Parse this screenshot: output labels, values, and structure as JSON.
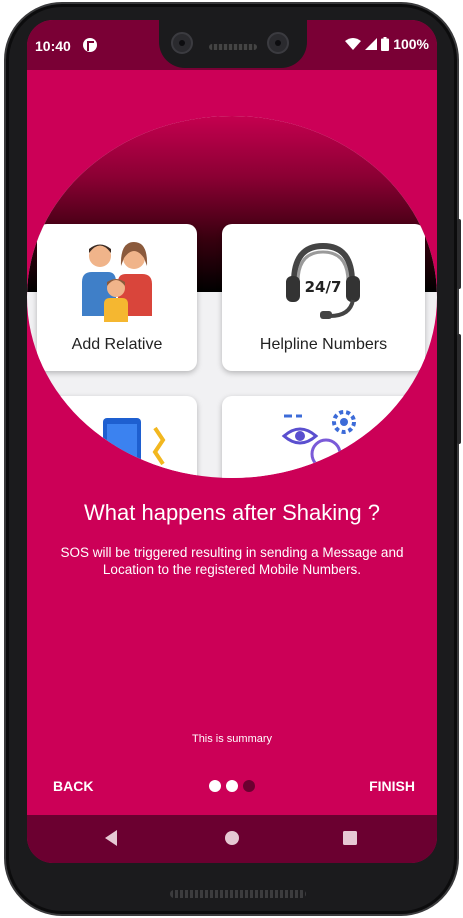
{
  "status_bar": {
    "time": "10:40",
    "battery": "100%",
    "icons": [
      "app-notification-icon",
      "wifi-icon",
      "signal-icon",
      "battery-icon"
    ]
  },
  "cards": [
    {
      "label": "Add Relative",
      "icon": "family-icon"
    },
    {
      "label": "Helpline Numbers",
      "icon": "headset-247-icon"
    },
    {
      "label": "",
      "icon": "phone-shake-icon"
    },
    {
      "label": "",
      "icon": "idea-settings-icon"
    }
  ],
  "intro": {
    "title": "What happens after Shaking ?",
    "description": "SOS will be triggered resulting in sending a Message and Location to the registered Mobile Numbers.",
    "summary": "This is summary"
  },
  "footer": {
    "back_label": "BACK",
    "finish_label": "FINISH",
    "page_indicator": {
      "total": 3,
      "active": 2
    }
  },
  "colors": {
    "background": "#cc0057",
    "status_bar": "#7a0035",
    "nav_bar": "#6b0030",
    "text": "#ffffff"
  },
  "system_nav": [
    "back-triangle-icon",
    "home-circle-icon",
    "recents-square-icon"
  ]
}
